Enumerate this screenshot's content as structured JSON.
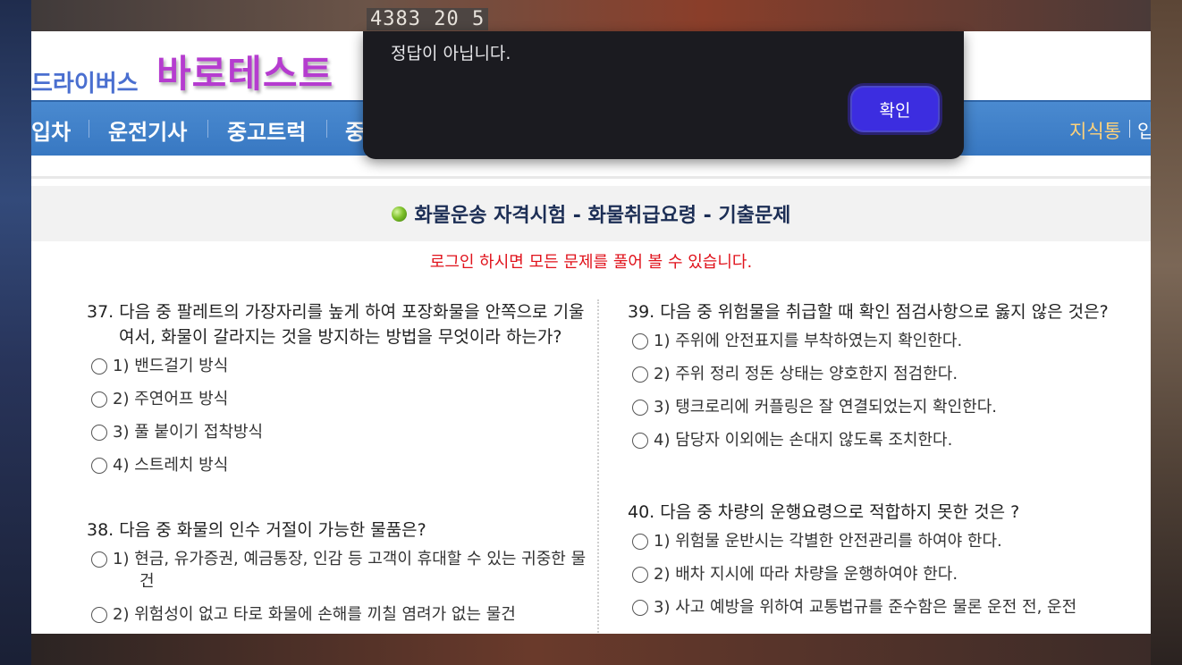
{
  "background": {
    "container_number": "4383 20 5"
  },
  "header": {
    "logo_small": "드라이버스",
    "logo_big": "바로테스트"
  },
  "nav": {
    "items": [
      "입차",
      "운전기사",
      "중고트럭",
      "중"
    ],
    "right_items": [
      "지식통",
      "입"
    ]
  },
  "title_bar": {
    "title": "화물운송 자격시험 - 화물취급요령 - 기출문제"
  },
  "login_notice": "로그인 하시면 모든 문제를 풀어 볼 수 있습니다.",
  "questions_left": [
    {
      "text": "37. 다음 중 팔레트의 가장자리를 높게 하여 포장화물을 안쪽으로 기울여서, 화물이 갈라지는 것을 방지하는 방법을 무엇이라 하는가?",
      "options": [
        "1) 밴드걸기 방식",
        "2) 주연어프 방식",
        "3) 풀 붙이기 접착방식",
        "4) 스트레치 방식"
      ]
    },
    {
      "text": "38. 다음 중 화물의 인수 거절이 가능한 물품은?",
      "options": [
        "1) 현금, 유가증권, 예금통장, 인감 등 고객이 휴대할 수 있는 귀중한 물건",
        "2) 위험성이 없고 타로 화물에 손해를 끼칠 염려가 없는 물건"
      ]
    }
  ],
  "questions_right": [
    {
      "text": "39. 다음 중 위험물을 취급할 때 확인 점검사항으로 옳지 않은 것은?",
      "options": [
        "1) 주위에 안전표지를 부착하였는지 확인한다.",
        "2) 주위 정리 정돈 상태는 양호한지 점검한다.",
        "3) 탱크로리에 커플링은 잘 연결되었는지 확인한다.",
        "4) 담당자 이외에는 손대지 않도록 조치한다."
      ]
    },
    {
      "text": "40. 다음 중 차량의 운행요령으로 적합하지 못한 것은 ?",
      "options": [
        "1) 위험물 운반시는 각별한 안전관리를 하여야 한다.",
        "2) 배차 지시에 따라 차량을 운행하여야 한다.",
        "3) 사고 예방을 위하여 교통법규를 준수함은 물론 운전 전, 운전"
      ]
    }
  ],
  "dialog": {
    "message": "정답이 아닙니다.",
    "confirm_label": "확인",
    "button_color": "#3c2de0"
  }
}
